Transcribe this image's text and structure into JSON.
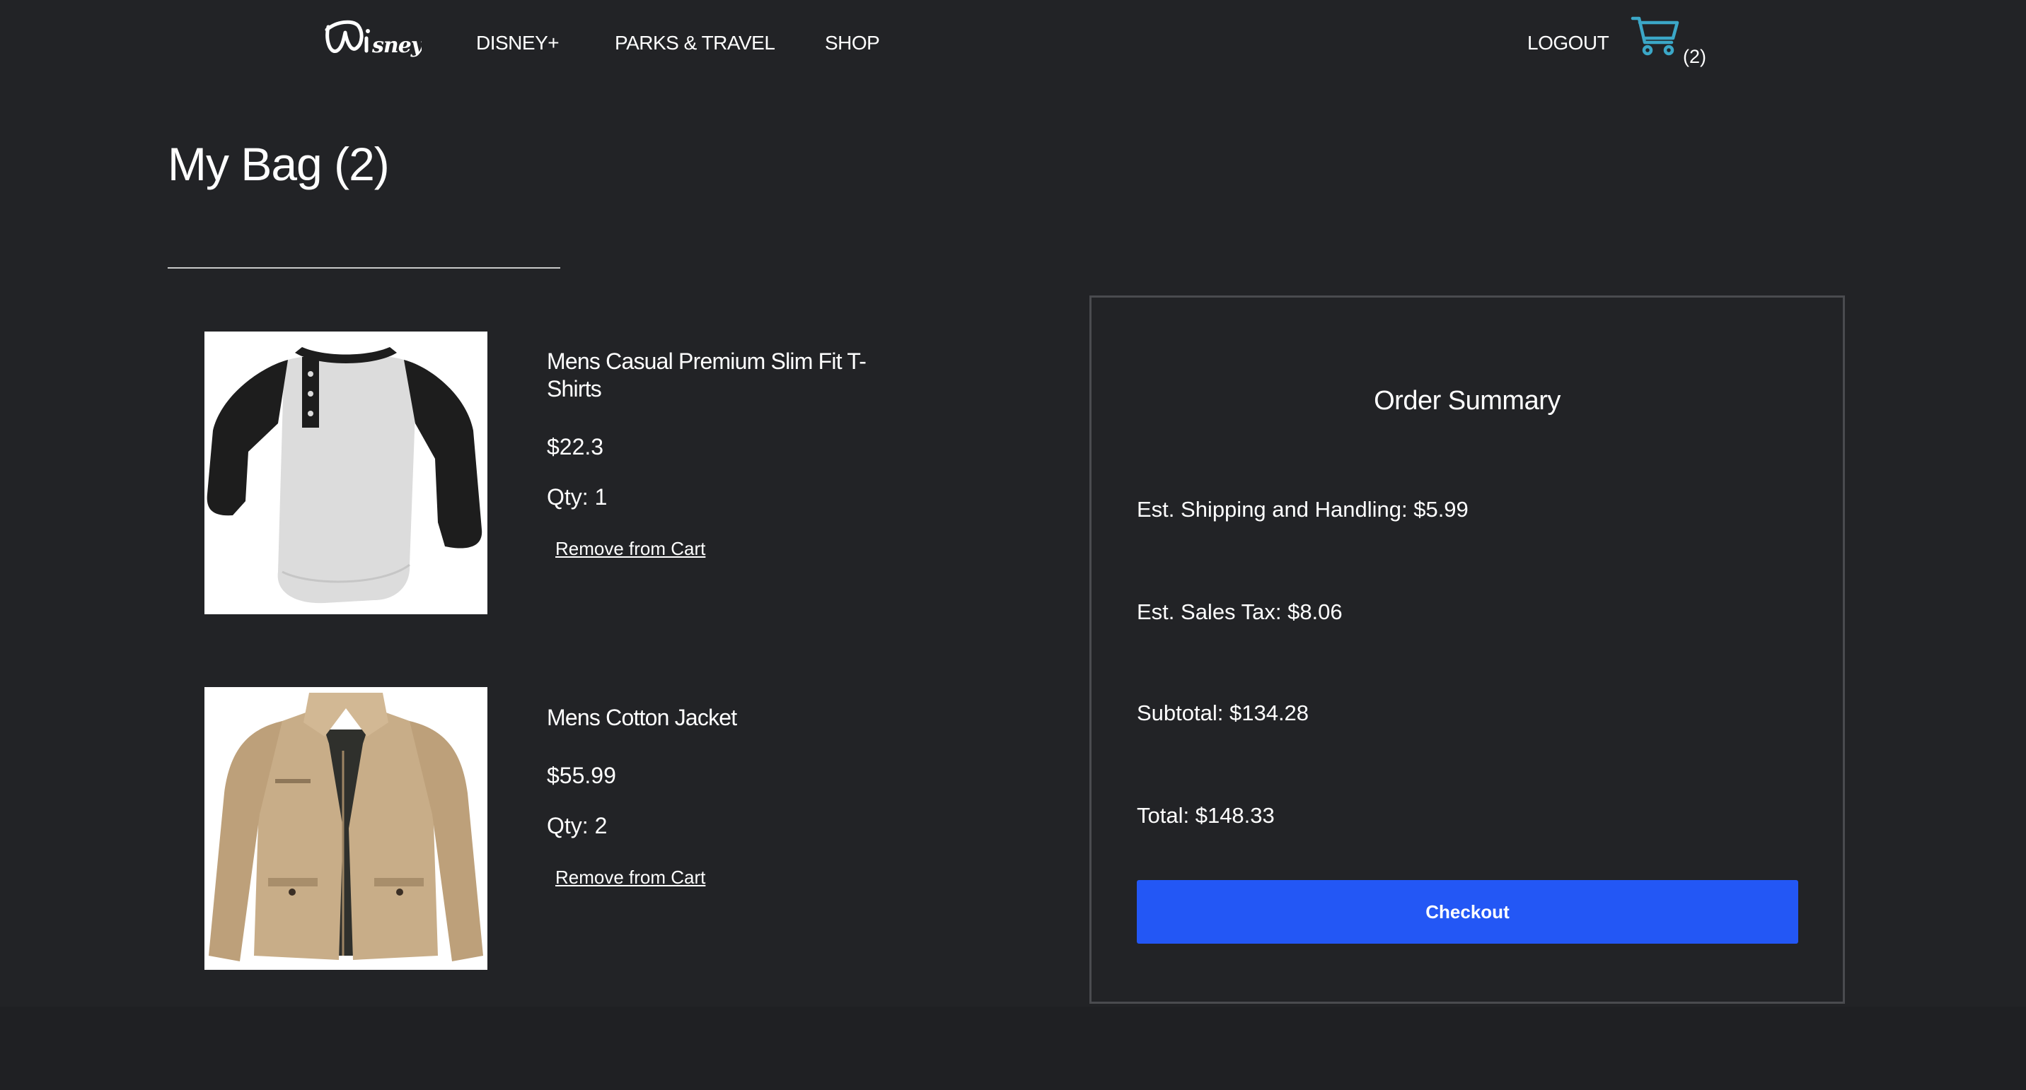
{
  "nav": {
    "brand": "Disney",
    "links": [
      "DISNEY+",
      "PARKS & TRAVEL",
      "SHOP"
    ],
    "logout_label": "LOGOUT",
    "cart_count": "(2)",
    "cart_icon_color": "#3ba7c7"
  },
  "bag": {
    "title": "My Bag (2)",
    "items": [
      {
        "name": "Mens Casual Premium Slim Fit T-Shirts",
        "price": "$22.3",
        "qty": "Qty: 1",
        "remove_label": "Remove from Cart",
        "image_icon": "raglan-henley-shirt-image"
      },
      {
        "name": "Mens Cotton Jacket",
        "price": "$55.99",
        "qty": "Qty: 2",
        "remove_label": "Remove from Cart",
        "image_icon": "khaki-cotton-jacket-image"
      }
    ]
  },
  "summary": {
    "title": "Order Summary",
    "shipping": "Est. Shipping and Handling: $5.99",
    "tax": "Est. Sales Tax: $8.06",
    "subtotal": "Subtotal: $134.28",
    "total": "Total: $148.33",
    "checkout_label": "Checkout",
    "checkout_color": "#2357f5"
  }
}
